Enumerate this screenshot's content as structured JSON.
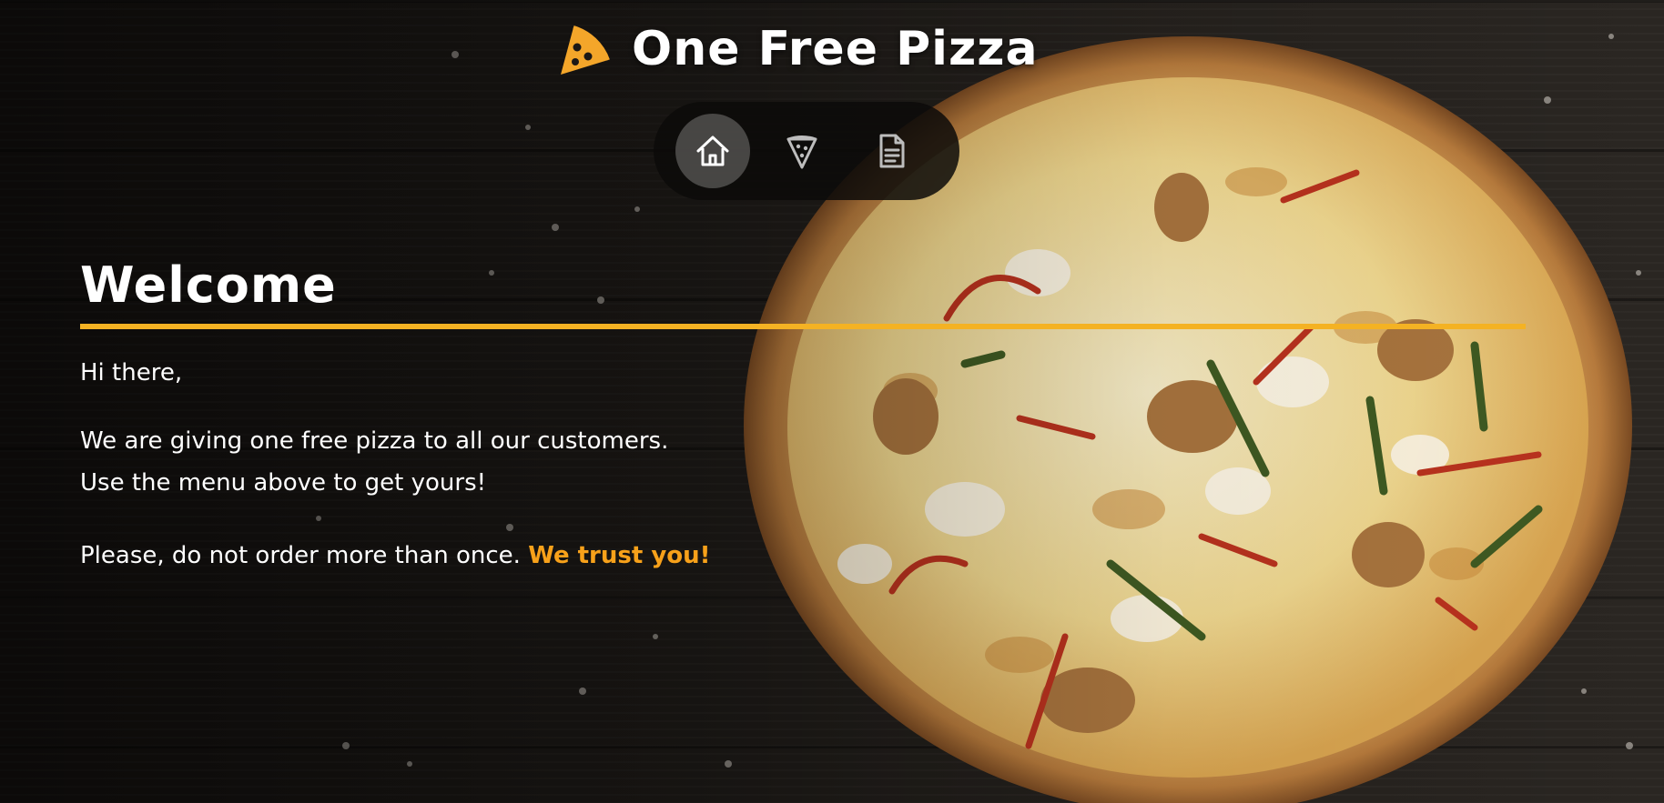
{
  "brand": {
    "title": "One Free Pizza",
    "logo_icon": "pizza-slice-icon",
    "logo_color": "#f4a62a"
  },
  "nav": {
    "items": [
      {
        "id": "home",
        "icon": "home-icon",
        "active": true
      },
      {
        "id": "pizza",
        "icon": "pizza-slice-icon",
        "active": false
      },
      {
        "id": "orders",
        "icon": "document-icon",
        "active": false
      }
    ]
  },
  "content": {
    "heading": "Welcome",
    "greeting": "Hi there,",
    "line1": "We are giving one free pizza to all our customers.",
    "line2": "Use the menu above to get yours!",
    "line3_text": "Please, do not order more than once.",
    "line3_accent": "We trust you!"
  },
  "colors": {
    "accent_rule": "#f4b223",
    "accent_text": "#f7a11a",
    "text": "#ffffff",
    "nav_background": "#0c0a09"
  }
}
